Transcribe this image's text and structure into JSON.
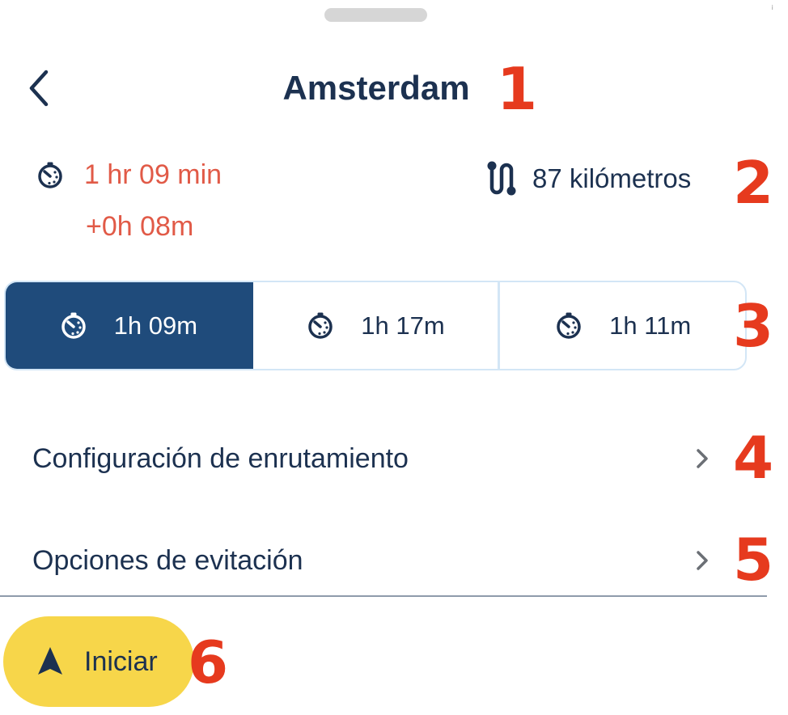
{
  "header": {
    "title": "Amsterdam",
    "back_icon": "chevron-left-icon"
  },
  "summary": {
    "duration": "1 hr 09 min",
    "delay": "+0h 08m",
    "distance": "87 kilómetros",
    "duration_icon": "stopwatch-icon",
    "distance_icon": "route-icon"
  },
  "routes": [
    {
      "label": "1h 09m",
      "selected": true
    },
    {
      "label": "1h 17m",
      "selected": false
    },
    {
      "label": "1h 11m",
      "selected": false
    }
  ],
  "settings": {
    "routing_label": "Configuración de enrutamiento",
    "avoid_label": "Opciones de evitación"
  },
  "start_button": {
    "label": "Iniciar",
    "icon": "navigation-arrow-icon"
  },
  "callouts": [
    "1",
    "2",
    "3",
    "4",
    "5",
    "6"
  ],
  "colors": {
    "primary": "#1c3150",
    "selected": "#1f4b7b",
    "alert": "#e15a47",
    "start": "#f7d64a",
    "callout": "#e63a1e"
  }
}
